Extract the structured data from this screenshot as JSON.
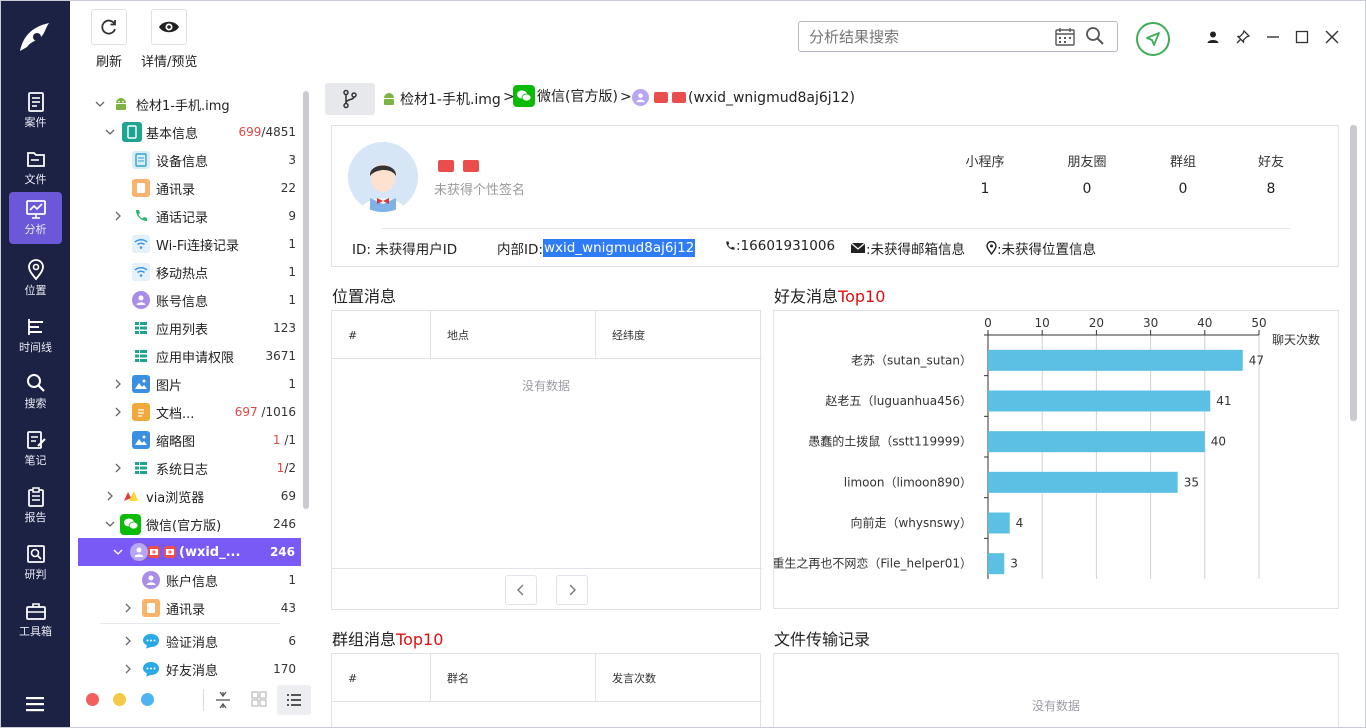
{
  "toolbar": {
    "refresh_label": "刷新",
    "detail_label": "详情/预览",
    "search_placeholder": "分析结果搜索"
  },
  "nav": {
    "items": [
      {
        "label": "案件",
        "icon": "case-icon"
      },
      {
        "label": "文件",
        "icon": "folder-icon"
      },
      {
        "label": "分析",
        "icon": "analysis-icon",
        "active": true
      },
      {
        "label": "位置",
        "icon": "location-icon"
      },
      {
        "label": "时间线",
        "icon": "timeline-icon"
      },
      {
        "label": "搜索",
        "icon": "search-icon"
      },
      {
        "label": "笔记",
        "icon": "note-icon"
      },
      {
        "label": "报告",
        "icon": "report-icon"
      },
      {
        "label": "研判",
        "icon": "judge-icon"
      },
      {
        "label": "工具箱",
        "icon": "toolbox-icon"
      }
    ]
  },
  "tree": {
    "root": {
      "label": "检材1-手机.img"
    },
    "basic": {
      "label": "基本信息",
      "count_red": "699",
      "count_total": "/4851"
    },
    "device": {
      "label": "设备信息",
      "count": "3"
    },
    "contacts": {
      "label": "通讯录",
      "count": "22"
    },
    "calls": {
      "label": "通话记录",
      "count": "9"
    },
    "wifi": {
      "label": "Wi-Fi连接记录",
      "count": "1"
    },
    "hotspot": {
      "label": "移动热点",
      "count": "1"
    },
    "account": {
      "label": "账号信息",
      "count": "1"
    },
    "apps": {
      "label": "应用列表",
      "count": "123"
    },
    "perms": {
      "label": "应用申请权限",
      "count": "3671"
    },
    "pics": {
      "label": "图片",
      "count": "1"
    },
    "docs": {
      "label": "文档...",
      "count_red": "697",
      "count_total": " /1016"
    },
    "thumbs": {
      "label": "缩略图",
      "count_red": "1",
      "count_total": " /1"
    },
    "syslog": {
      "label": "系统日志",
      "count_red": "1",
      "count_total": "/2"
    },
    "via": {
      "label": "via浏览器",
      "count": "69"
    },
    "wechat": {
      "label": "微信(官方版)",
      "count": "246"
    },
    "wxuser": {
      "label": "(wxid_...",
      "count": "246"
    },
    "acctinfo": {
      "label": "账户信息",
      "count": "1"
    },
    "wxcontacts": {
      "label": "通讯录",
      "count": "43"
    },
    "verify": {
      "label": "验证消息",
      "count": "6"
    },
    "friendmsg": {
      "label": "好友消息",
      "count": "170"
    }
  },
  "breadcrumb": {
    "seg1": "检材1-手机.img",
    "seg2": "微信(官方版)",
    "seg3": "(wxid_wnigmud8aj6j12)",
    "sep": ">"
  },
  "profile": {
    "signature": "未获得个性签名",
    "stats": [
      {
        "label": "小程序",
        "value": "1"
      },
      {
        "label": "朋友圈",
        "value": "0"
      },
      {
        "label": "群组",
        "value": "0"
      },
      {
        "label": "好友",
        "value": "8"
      }
    ],
    "id_label": "ID: 未获得用户ID",
    "internal_id_label": "内部ID: ",
    "internal_id_value": "wxid_wnigmud8aj6j12",
    "phone": ":16601931006",
    "email": ":未获得邮箱信息",
    "location": ":未获得位置信息"
  },
  "location_section": {
    "title": "位置消息",
    "columns": [
      "#",
      "地点",
      "经纬度"
    ],
    "empty": "没有数据"
  },
  "friend_section": {
    "title": "好友消息",
    "title_red": "Top10"
  },
  "group_section": {
    "title": "群组消息",
    "title_red": "Top10",
    "columns": [
      "#",
      "群名",
      "发言次数"
    ]
  },
  "file_section": {
    "title": "文件传输记录",
    "empty": "没有数据"
  },
  "chart_data": {
    "type": "bar",
    "orientation": "horizontal",
    "categories": [
      "老苏（sutan_sutan）",
      "赵老五（luguanhua456）",
      "愚蠢的土拨鼠（sstt119999）",
      "limoon（limoon890）",
      "向前走（whysnswy）",
      "重生之再也不网恋（File_helper01）"
    ],
    "values": [
      47,
      41,
      40,
      35,
      4,
      3
    ],
    "xlabel": "聊天次数",
    "xlim": [
      0,
      50
    ],
    "ticks": [
      0,
      10,
      20,
      30,
      40,
      50
    ],
    "color": "#5bc0e3",
    "grid": true
  },
  "colors": {
    "nav_bg": "#1c2244",
    "accent": "#7a5af4",
    "top10_red": "#e01010",
    "bar": "#5bc0e3",
    "highlight": "#2e7cf6"
  }
}
